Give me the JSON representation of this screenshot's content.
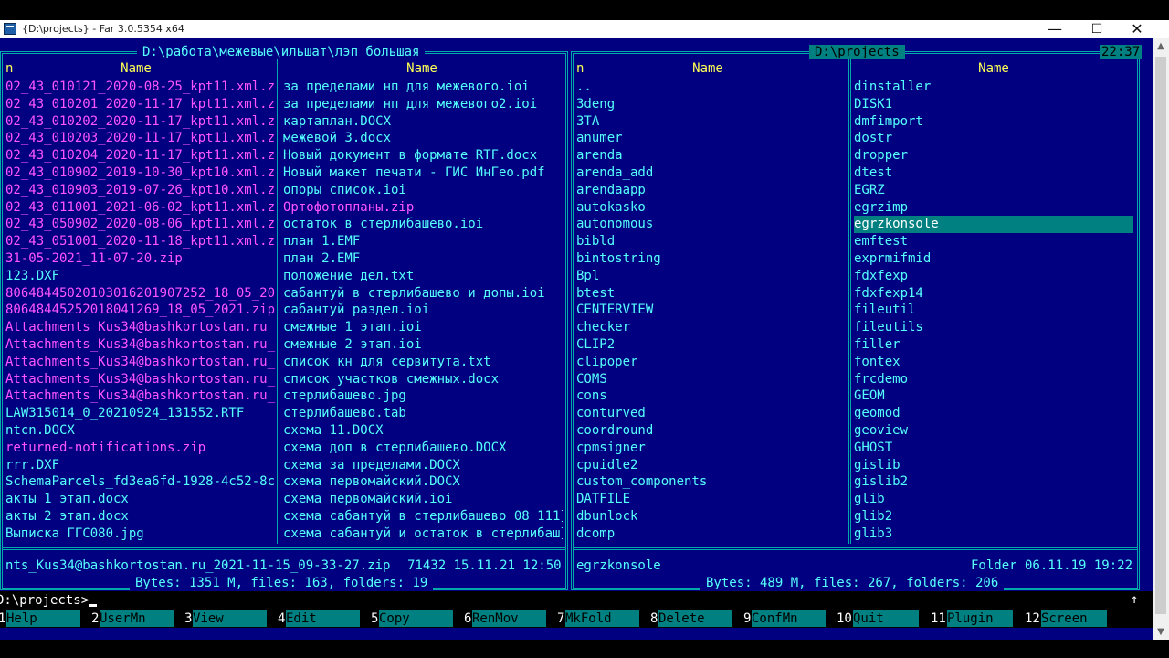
{
  "window": {
    "title": "{D:\\projects} - Far 3.0.5354 x64",
    "minimize": "—",
    "maximize": "☐",
    "close": "✕"
  },
  "left_panel": {
    "path": "D:\\работа\\межевые\\ильшат\\лэп большая",
    "col1_header_n": "n",
    "col1_header": "Name",
    "col2_header": "Name",
    "col1": [
      {
        "name": "02_43_010121_2020-08-25_kpt11.xml.z}",
        "color": "magenta"
      },
      {
        "name": "02_43_010201_2020-11-17_kpt11.xml.z}",
        "color": "magenta"
      },
      {
        "name": "02_43_010202_2020-11-17_kpt11.xml.z}",
        "color": "magenta"
      },
      {
        "name": "02_43_010203_2020-11-17_kpt11.xml.z}",
        "color": "magenta"
      },
      {
        "name": "02_43_010204_2020-11-17_kpt11.xml.z}",
        "color": "magenta"
      },
      {
        "name": "02_43_010902_2019-10-30_kpt10.xml.z}",
        "color": "magenta"
      },
      {
        "name": "02_43_010903_2019-07-26_kpt10.xml.z}",
        "color": "magenta"
      },
      {
        "name": "02_43_011001_2021-06-02_kpt11.xml.z}",
        "color": "magenta"
      },
      {
        "name": "02_43_050902_2020-08-06_kpt11.xml.z}",
        "color": "magenta"
      },
      {
        "name": "02_43_051001_2020-11-18_kpt11.xml.z}",
        "color": "magenta"
      },
      {
        "name": "31-05-2021_11-07-20.zip",
        "color": "magenta"
      },
      {
        "name": "123.DXF",
        "color": "cyan"
      },
      {
        "name": "80648445020103016201907252_18_05_20}",
        "color": "magenta"
      },
      {
        "name": "80648445252018041269_18_05_2021.zip",
        "color": "magenta"
      },
      {
        "name": "Attachments_Kus34@bashkortostan.ru_}",
        "color": "magenta"
      },
      {
        "name": "Attachments_Kus34@bashkortostan.ru_}",
        "color": "magenta"
      },
      {
        "name": "Attachments_Kus34@bashkortostan.ru_}",
        "color": "magenta"
      },
      {
        "name": "Attachments_Kus34@bashkortostan.ru_}",
        "color": "magenta"
      },
      {
        "name": "Attachments_Kus34@bashkortostan.ru_}",
        "color": "magenta"
      },
      {
        "name": "LAW315014_0_20210924_131552.RTF",
        "color": "cyan"
      },
      {
        "name": "ntcn.DOCX",
        "color": "cyan"
      },
      {
        "name": "returned-notifications.zip",
        "color": "magenta"
      },
      {
        "name": "rrr.DXF",
        "color": "cyan"
      },
      {
        "name": "SchemaParcels_fd3ea6fd-1928-4c52-8c}",
        "color": "cyan"
      },
      {
        "name": "акты 1 этап.docx",
        "color": "cyan"
      },
      {
        "name": "акты 2 этап.docx",
        "color": "cyan"
      },
      {
        "name": "Выписка ГГС080.jpg",
        "color": "cyan"
      }
    ],
    "col2": [
      {
        "name": "за пределами нп для межевого.ioi",
        "color": "cyan"
      },
      {
        "name": "за пределами нп для межевого2.ioi",
        "color": "cyan"
      },
      {
        "name": "картаплан.DOCX",
        "color": "cyan"
      },
      {
        "name": "межевой 3.docx",
        "color": "cyan"
      },
      {
        "name": "Новый документ в формате RTF.docx",
        "color": "cyan"
      },
      {
        "name": "Новый макет печати - ГИС ИнГео.pdf",
        "color": "cyan"
      },
      {
        "name": "опоры список.ioi",
        "color": "cyan"
      },
      {
        "name": "Ортофотопланы.zip",
        "color": "magenta"
      },
      {
        "name": "остаток в стерлибашево.ioi",
        "color": "cyan"
      },
      {
        "name": "план 1.EMF",
        "color": "cyan"
      },
      {
        "name": "план 2.EMF",
        "color": "cyan"
      },
      {
        "name": "положение дел.txt",
        "color": "cyan"
      },
      {
        "name": "сабантуй в стерлибашево и допы.ioi",
        "color": "cyan"
      },
      {
        "name": "сабантуй раздел.ioi",
        "color": "cyan"
      },
      {
        "name": "смежные 1 этап.ioi",
        "color": "cyan"
      },
      {
        "name": "смежные 2 этап.ioi",
        "color": "cyan"
      },
      {
        "name": "список кн для сервитута.txt",
        "color": "cyan"
      },
      {
        "name": "список участков смежных.docx",
        "color": "cyan"
      },
      {
        "name": "стерлибашево.jpg",
        "color": "cyan"
      },
      {
        "name": "стерлибашево.tab",
        "color": "cyan"
      },
      {
        "name": "схема 11.DOCX",
        "color": "cyan"
      },
      {
        "name": "схема доп в стерлибашево.DOCX",
        "color": "cyan"
      },
      {
        "name": "схема за пределами.DOCX",
        "color": "cyan"
      },
      {
        "name": "схема первомайский.DOCX",
        "color": "cyan"
      },
      {
        "name": "схема первомайский.ioi",
        "color": "cyan"
      },
      {
        "name": "схема сабантуй в стерлибашево 08 111}",
        "color": "cyan"
      },
      {
        "name": "схема сабантуй и остаток в стерлибаш}",
        "color": "cyan"
      }
    ],
    "status_name": "nts_Kus34@bashkortostan.ru_2021-11-15_09-33-27.zip",
    "status_info": "71432 15.11.21 12:50",
    "summary": "Bytes: 1351 M, files: 163, folders: 19"
  },
  "right_panel": {
    "path": "D:\\projects",
    "clock": "22:37",
    "col1_header_n": "n",
    "col1_header": "Name",
    "col2_header": "Name",
    "col1": [
      "..",
      "3deng",
      "3TA",
      "anumer",
      "arenda",
      "arenda_add",
      "arendaapp",
      "autokasko",
      "autonomous",
      "bibld",
      "bintostring",
      "Bpl",
      "btest",
      "CENTERVIEW",
      "checker",
      "CLIP2",
      "clipoper",
      "COMS",
      "cons",
      "conturved",
      "coordround",
      "cpmsigner",
      "cpuidle2",
      "custom_components",
      "DATFILE",
      "dbunlock",
      "dcomp"
    ],
    "col2": [
      "dinstaller",
      "DISK1",
      "dmfimport",
      "dostr",
      "dropper",
      "dtest",
      "EGRZ",
      "egrzimp",
      "egrzkonsole",
      "emftest",
      "exprmifmid",
      "fdxfexp",
      "fdxfexp14",
      "fileutil",
      "fileutils",
      "filler",
      "fontex",
      "frcdemo",
      "GEOM",
      "geomod",
      "geoview",
      "GHOST",
      "gislib",
      "gislib2",
      "glib",
      "glib2",
      "glib3"
    ],
    "selected": "egrzkonsole",
    "status_name": "egrzkonsole",
    "status_info": "Folder 06.11.19 19:22",
    "summary": "Bytes: 489 M, files: 267, folders: 206"
  },
  "command_line": {
    "prompt": "D:\\projects>",
    "up_arrow": "↑"
  },
  "keybar": [
    {
      "num": "1",
      "label": "Help"
    },
    {
      "num": "2",
      "label": "UserMn"
    },
    {
      "num": "3",
      "label": "View"
    },
    {
      "num": "4",
      "label": "Edit"
    },
    {
      "num": "5",
      "label": "Copy"
    },
    {
      "num": "6",
      "label": "RenMov"
    },
    {
      "num": "7",
      "label": "MkFold"
    },
    {
      "num": "8",
      "label": "Delete"
    },
    {
      "num": "9",
      "label": "ConfMn"
    },
    {
      "num": "10",
      "label": "Quit"
    },
    {
      "num": "11",
      "label": "Plugin"
    },
    {
      "num": "12",
      "label": "Screen"
    }
  ],
  "colors": {
    "background": "#000080",
    "frame": "#00aaaa",
    "text": "#55ffff",
    "archive": "#ff55ff",
    "header": "#ffff55",
    "selection": "#008080"
  }
}
